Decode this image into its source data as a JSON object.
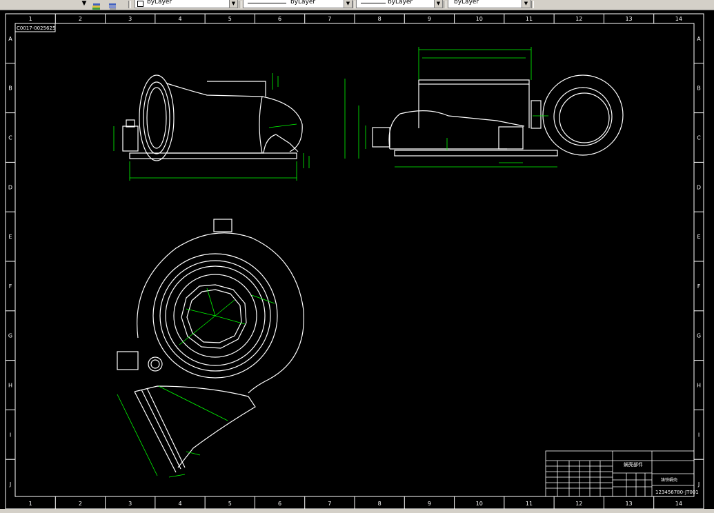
{
  "toolbar": {
    "layer_combo": "byLayer",
    "linetype_combo": "byLayer",
    "lineweight_combo": "byLayer",
    "plotstyle_combo": "byLayer"
  },
  "frame": {
    "columns": [
      "1",
      "2",
      "3",
      "4",
      "5",
      "6",
      "7",
      "8",
      "9",
      "10",
      "11",
      "12",
      "13",
      "14"
    ],
    "rows": [
      "A",
      "B",
      "C",
      "D",
      "E",
      "F",
      "G",
      "H",
      "I",
      "J"
    ],
    "corner_code": "C0017-0025625"
  },
  "title_block": {
    "title": "蜗壳部件",
    "part_name": "铸铁蜗壳",
    "drawing_number": "123456780-JT001"
  },
  "colors": {
    "background": "#000000",
    "geometry": "#ffffff",
    "dimensions": "#00ff00",
    "toolbar": "#d4d0c8"
  }
}
